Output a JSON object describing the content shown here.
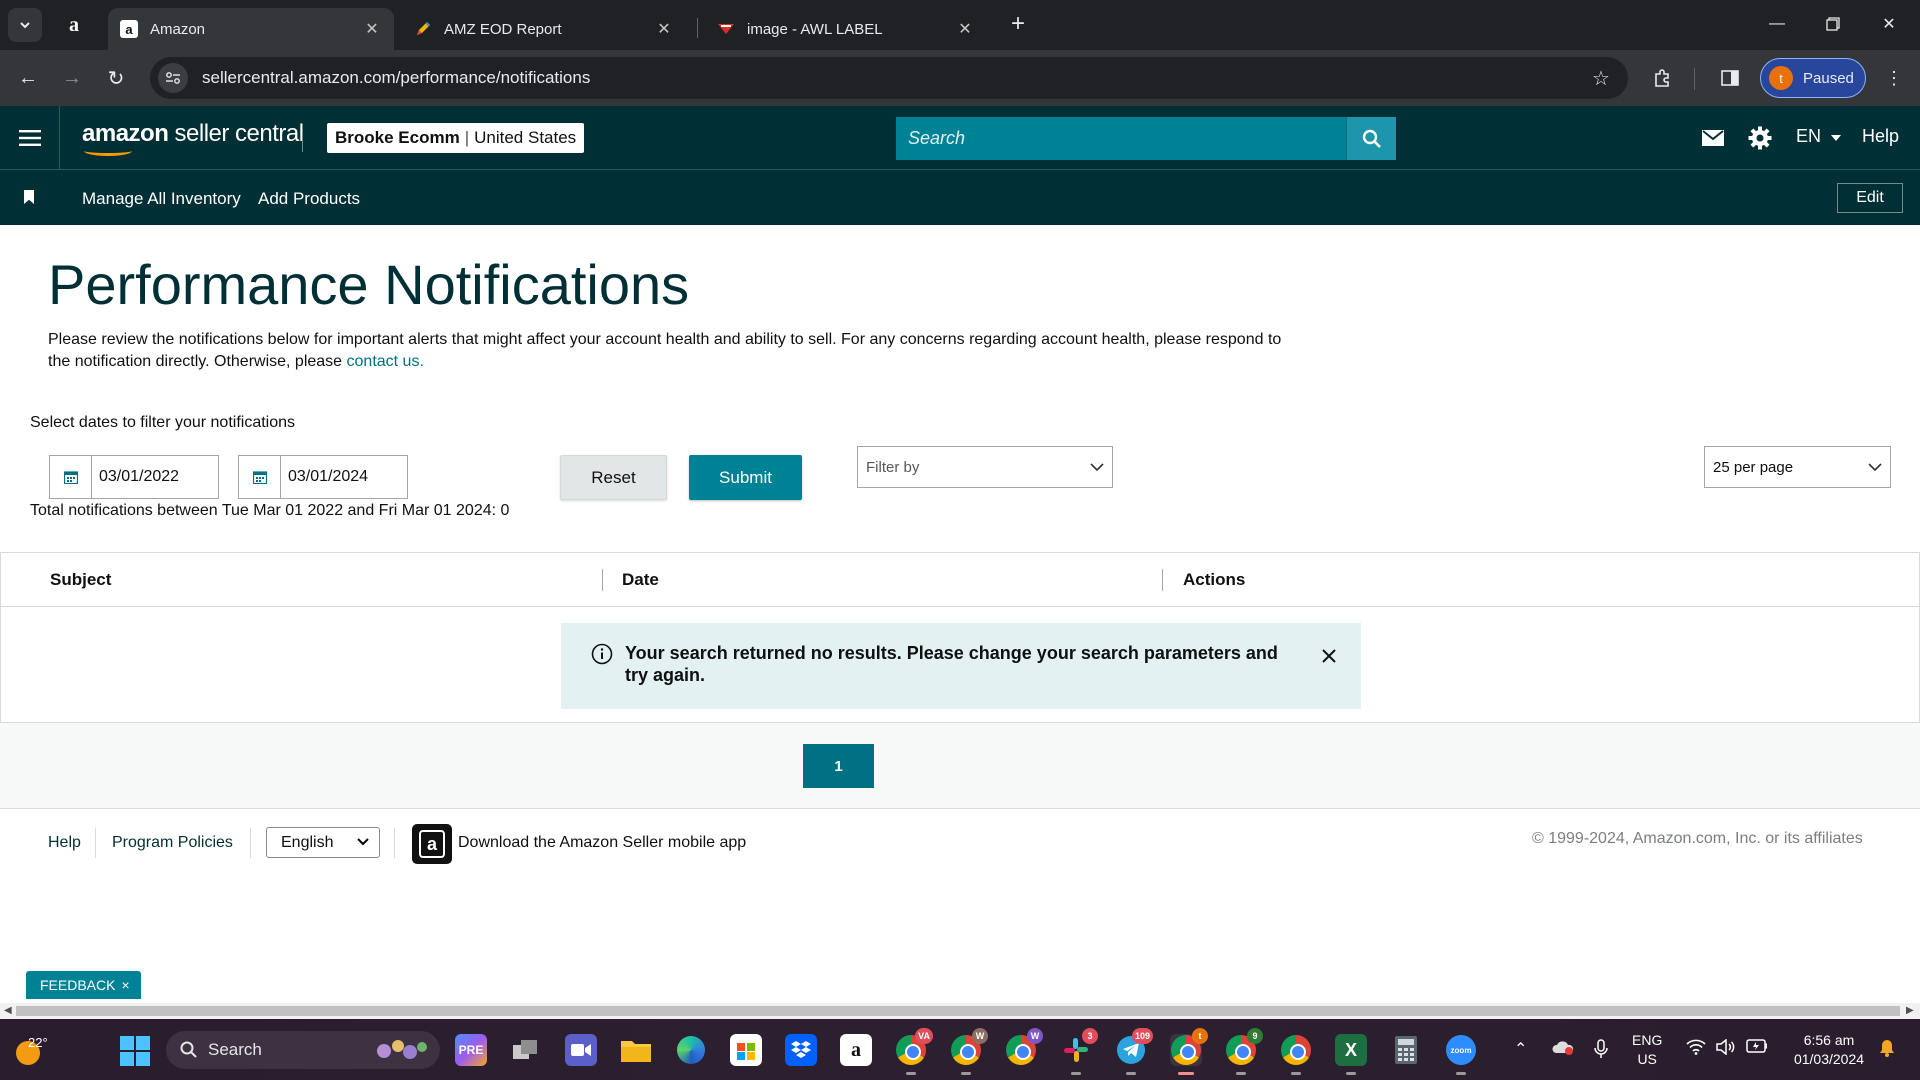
{
  "browser": {
    "tabs": [
      {
        "title": "Amazon",
        "favicon": "amazon-a",
        "active": true
      },
      {
        "title": "AMZ EOD Report",
        "favicon": "sheets-pencil",
        "active": false
      },
      {
        "title": "image - AWL LABEL",
        "favicon": "awl-logo",
        "active": false
      }
    ],
    "url": "sellercentral.amazon.com/performance/notifications",
    "profile_initial": "t",
    "profile_status": "Paused"
  },
  "header": {
    "logo_bold": "amazon",
    "logo_rest": " seller central",
    "account_name": "Brooke Ecomm",
    "account_region": "United States",
    "search_placeholder": "Search",
    "language": "EN",
    "help": "Help"
  },
  "subnav": {
    "links": [
      "Manage All Inventory",
      "Add Products"
    ],
    "edit": "Edit"
  },
  "page": {
    "title": "Performance Notifications",
    "intro_text": "Please review the notifications below for important alerts that might affect your account health and ability to sell. For any concerns regarding account health, please respond to the notification directly. Otherwise, please ",
    "intro_link": "contact us."
  },
  "filters": {
    "label": "Select dates to filter your notifications",
    "start_date": "03/01/2022",
    "end_date": "03/01/2024",
    "reset": "Reset",
    "submit": "Submit",
    "filter_by": "Filter by",
    "per_page": "25 per page",
    "total": "Total notifications between Tue Mar 01 2022 and Fri Mar 01 2024: 0"
  },
  "table": {
    "columns": [
      "Subject",
      "Date",
      "Actions"
    ],
    "empty_message": "Your search returned no results. Please change your search parameters and try again."
  },
  "pagination": {
    "current": "1"
  },
  "footer": {
    "help": "Help",
    "policies": "Program Policies",
    "language": "English",
    "app_link": "Download the Amazon Seller mobile app",
    "copyright": "© 1999-2024, Amazon.com, Inc. or its affiliates"
  },
  "feedback": {
    "label": "FEEDBACK",
    "close": "×"
  },
  "taskbar": {
    "temperature": "22°",
    "search": "Search",
    "badges": {
      "chrome_1": "VA",
      "chrome_2": "W",
      "chrome_3": "W",
      "slack": "3",
      "telegram": "109",
      "chrome_active": "t",
      "chrome_4": "9"
    },
    "lang_line1": "ENG",
    "lang_line2": "US",
    "time": "6:56 am",
    "date": "01/03/2024"
  },
  "colors": {
    "header_bg": "#002f36",
    "accent_teal": "#008296",
    "link": "#007185"
  }
}
